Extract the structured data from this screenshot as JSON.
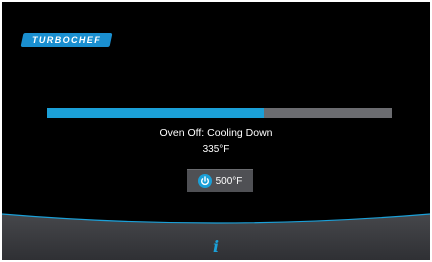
{
  "brand": {
    "logo_text": "TURBOCHEF"
  },
  "progress": {
    "fraction": 0.63
  },
  "status": {
    "message": "Oven Off: Cooling Down",
    "current_temp": "335°F"
  },
  "setpoint_button": {
    "label": "500°F",
    "icon": "power-icon"
  },
  "footer": {
    "info_icon": "info-icon",
    "info_glyph": "i"
  },
  "colors": {
    "background": "#000000",
    "accent": "#1ba0d8",
    "progress_track": "#6b6c70",
    "button_bg": "#4f5054",
    "footer_bg": "#3a3b3f"
  }
}
